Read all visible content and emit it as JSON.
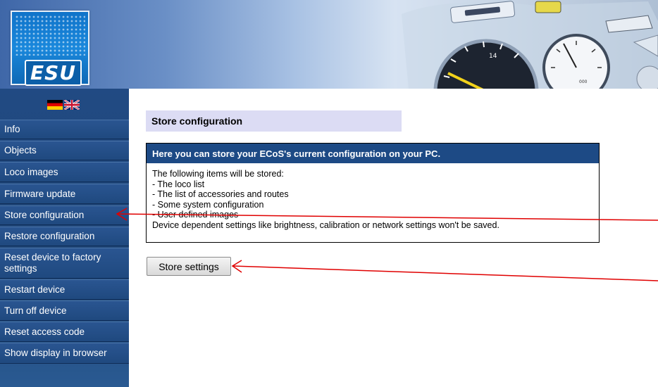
{
  "header": {
    "logo_text": "ESU",
    "gauge_readout_1": "14",
    "gauge_readout_2": "000"
  },
  "languages": [
    {
      "code": "de",
      "icon": "german-flag-icon"
    },
    {
      "code": "en",
      "icon": "uk-flag-icon"
    }
  ],
  "sidebar": {
    "items": [
      {
        "label": "Info"
      },
      {
        "label": "Objects"
      },
      {
        "label": "Loco images"
      },
      {
        "label": "Firmware update"
      },
      {
        "label": "Store configuration"
      },
      {
        "label": "Restore configuration"
      },
      {
        "label": "Reset device to factory settings"
      },
      {
        "label": "Restart device"
      },
      {
        "label": "Turn off device"
      },
      {
        "label": "Reset access code"
      },
      {
        "label": "Show display in browser"
      }
    ]
  },
  "main": {
    "page_title": "Store configuration",
    "panel": {
      "heading": "Here you can store your ECoS's current configuration on your PC.",
      "lines": [
        "The following items will be stored:",
        "- The loco list",
        "- The list of accessories and routes",
        "- Some system configuration",
        "- User defined images",
        "Device dependent settings like brightness, calibration or network settings won't be saved."
      ]
    },
    "store_button_label": "Store settings"
  },
  "colors": {
    "sidebar_bg": "#214a83",
    "panel_header_bg": "#1d4a85",
    "title_bg": "#dcdcf4",
    "annotation_arrow": "#e00000"
  }
}
